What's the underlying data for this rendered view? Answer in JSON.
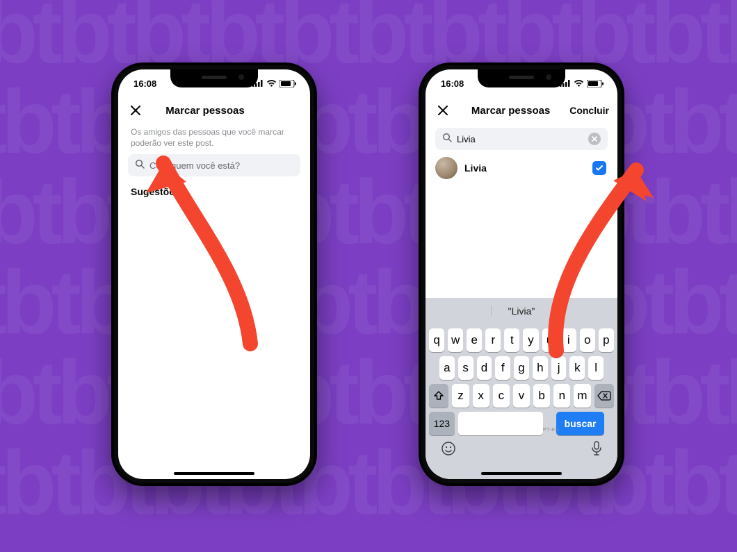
{
  "statusbar": {
    "time": "16:08"
  },
  "phone_left": {
    "title": "Marcar pessoas",
    "note": "Os amigos das pessoas que você marcar poderão ver este post.",
    "search_placeholder": "Com quem você está?",
    "section_label": "Sugestões"
  },
  "phone_right": {
    "title": "Marcar pessoas",
    "done_label": "Concluir",
    "search_value": "Livia",
    "result_name": "Livia"
  },
  "keyboard": {
    "suggestion": "\"Livia\"",
    "row1": [
      "q",
      "w",
      "e",
      "r",
      "t",
      "y",
      "u",
      "i",
      "o",
      "p"
    ],
    "row2": [
      "a",
      "s",
      "d",
      "f",
      "g",
      "h",
      "j",
      "k",
      "l"
    ],
    "row3": [
      "z",
      "x",
      "c",
      "v",
      "b",
      "n",
      "m"
    ],
    "mode_key": "123",
    "search_key": "buscar",
    "space_hint": "PT-EN"
  }
}
